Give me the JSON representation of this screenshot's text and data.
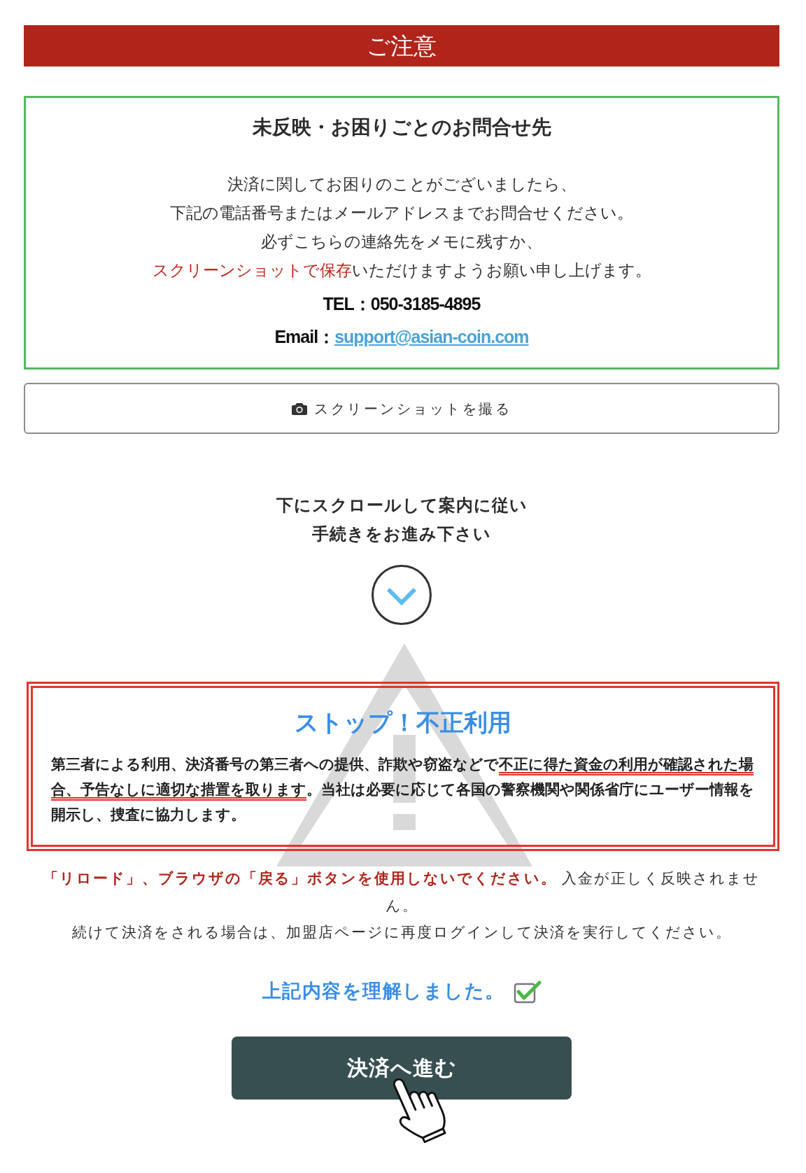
{
  "header": {
    "title": "ご注意"
  },
  "contact_box": {
    "title": "未反映・お困りごとのお問合せ先",
    "message_lines": [
      {
        "segments": [
          {
            "text": "決済に関してお困りのことがございましたら、",
            "emphasized": false
          }
        ]
      },
      {
        "segments": [
          {
            "text": "下記の電話番号またはメールアドレスまでお問合せください。",
            "emphasized": false
          }
        ]
      },
      {
        "segments": [
          {
            "text": "必ずこちらの連絡先をメモに残すか、",
            "emphasized": false
          }
        ]
      },
      {
        "segments": [
          {
            "text": "スクリーンショットで保存",
            "emphasized": true
          },
          {
            "text": "いただけますようお願い申し上げます。",
            "emphasized": false
          }
        ]
      }
    ],
    "contacts": [
      {
        "kind": "phone",
        "label": "TEL：",
        "value": "050-3185-4895"
      },
      {
        "kind": "email",
        "label": "Email：",
        "value": "support@asian-coin.com"
      }
    ]
  },
  "screenshot_button": {
    "label": "スクリーンショットを撮る"
  },
  "scroll_hint": {
    "lines": [
      "下にスクロールして案内に従い",
      "手続きをお進み下さい"
    ]
  },
  "fraud_warning": {
    "title": "ストップ！不正利用",
    "segments": [
      {
        "text": "第三者による利用、決済番号の第三者への提供、詐欺や窃盗などで",
        "underlined": false
      },
      {
        "text": "不正に得た資金の利用が確認された場合、予告なしに適切な措置を取ります",
        "underlined": true
      },
      {
        "text": "。当社は必要に応じて各国の警察機関や関係省庁にユーザー情報を開示し、捜査に協力します。",
        "underlined": false
      }
    ]
  },
  "notice": {
    "lines": [
      {
        "segments": [
          {
            "text": "「リロード」、ブラウザの「戻る」ボタンを使用しないでください。",
            "emphasized": true
          },
          {
            "text": " 入金が正しく反映されません。",
            "emphasized": false
          }
        ]
      },
      {
        "segments": [
          {
            "text": "続けて決済をされる場合は、加盟店ページに再度ログインして決済を実行してください。",
            "emphasized": false
          }
        ]
      }
    ]
  },
  "agreement": {
    "label": "上記内容を理解しました。",
    "checked": true
  },
  "proceed_button": {
    "label": "決済へ進む"
  }
}
